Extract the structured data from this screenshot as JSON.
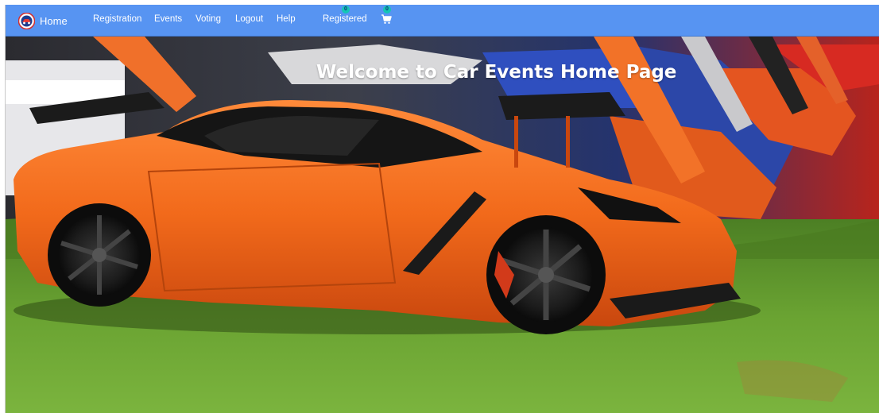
{
  "nav": {
    "brand_label": "Home",
    "links": [
      "Registration",
      "Events",
      "Voting",
      "Logout",
      "Help",
      "Registered"
    ],
    "registered_badge": "0",
    "cart_badge": "0"
  },
  "hero": {
    "title": "Welcome to Car Events Home Page"
  },
  "colors": {
    "navbar": "#5794f2",
    "badge": "#14c7b6",
    "car_primary": "#f26a1b"
  },
  "icons": {
    "logo": "car-events-logo-icon",
    "cart": "shopping-cart-icon"
  }
}
